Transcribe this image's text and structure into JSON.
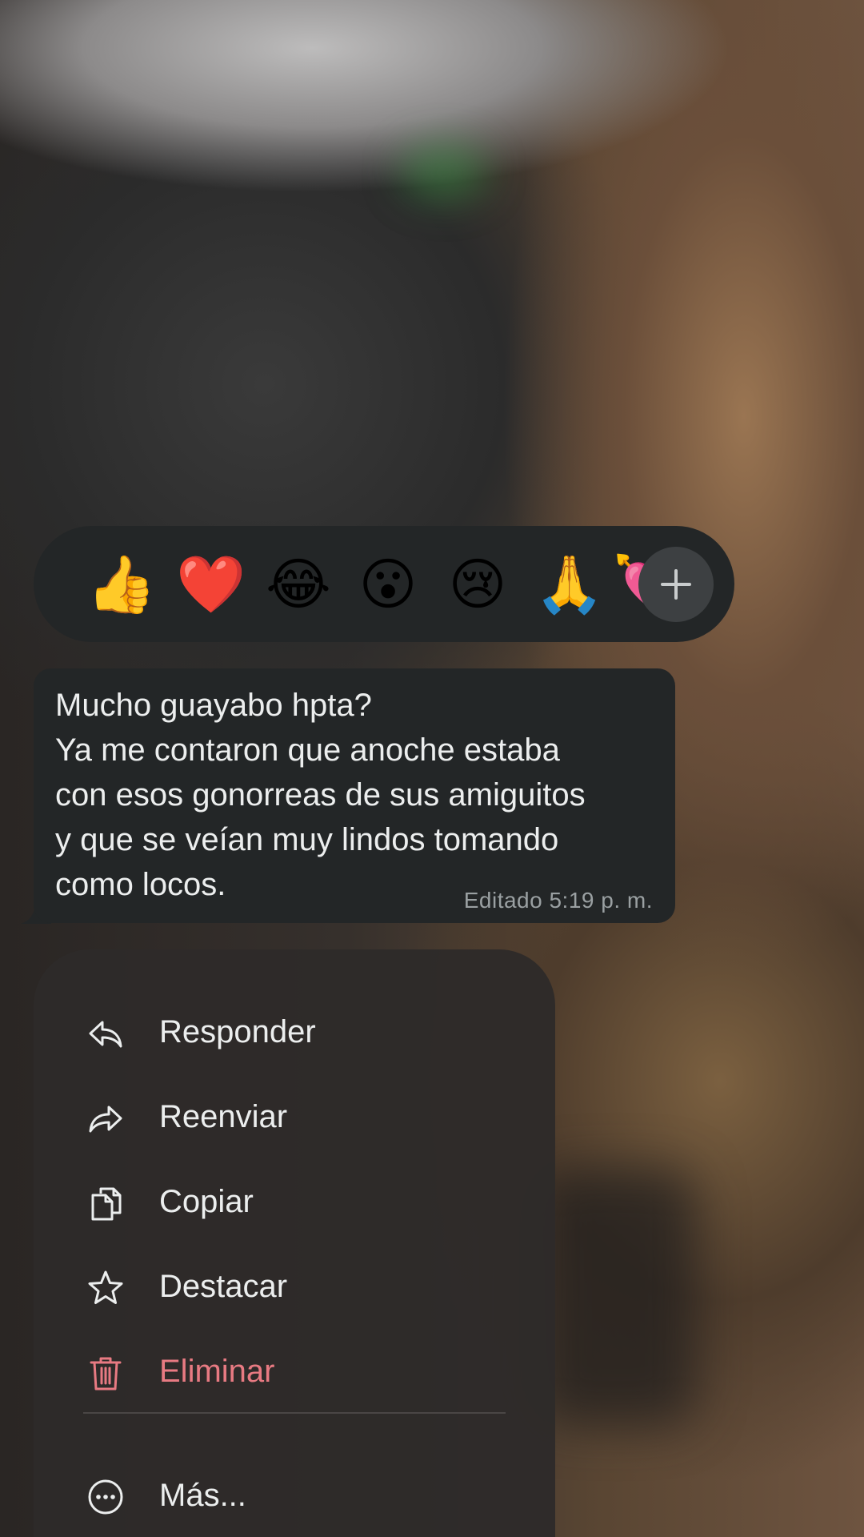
{
  "reactions": {
    "emojis": [
      "👍",
      "❤️",
      "😂",
      "😮",
      "😢",
      "🙏",
      "💘"
    ],
    "add_icon": "plus-icon"
  },
  "message": {
    "lines": [
      "Mucho guayabo hpta?",
      "Ya me contaron que anoche estaba",
      "con esos gonorreas de sus amiguitos",
      "y que se veían muy lindos tomando",
      "como locos."
    ],
    "edited_label": "Editado",
    "time": "5:19 p. m."
  },
  "menu": {
    "items": [
      {
        "label": "Responder",
        "icon": "reply-icon"
      },
      {
        "label": "Reenviar",
        "icon": "forward-icon"
      },
      {
        "label": "Copiar",
        "icon": "copy-icon"
      },
      {
        "label": "Destacar",
        "icon": "star-icon"
      },
      {
        "label": "Eliminar",
        "icon": "trash-icon",
        "color": "#e87a82"
      },
      {
        "label": "Más...",
        "icon": "more-icon"
      }
    ]
  },
  "colors": {
    "bubble": "#232627",
    "menu": "#2e2b2a",
    "danger": "#e87a82",
    "text": "#eceeee",
    "meta": "#9aa0a2"
  }
}
